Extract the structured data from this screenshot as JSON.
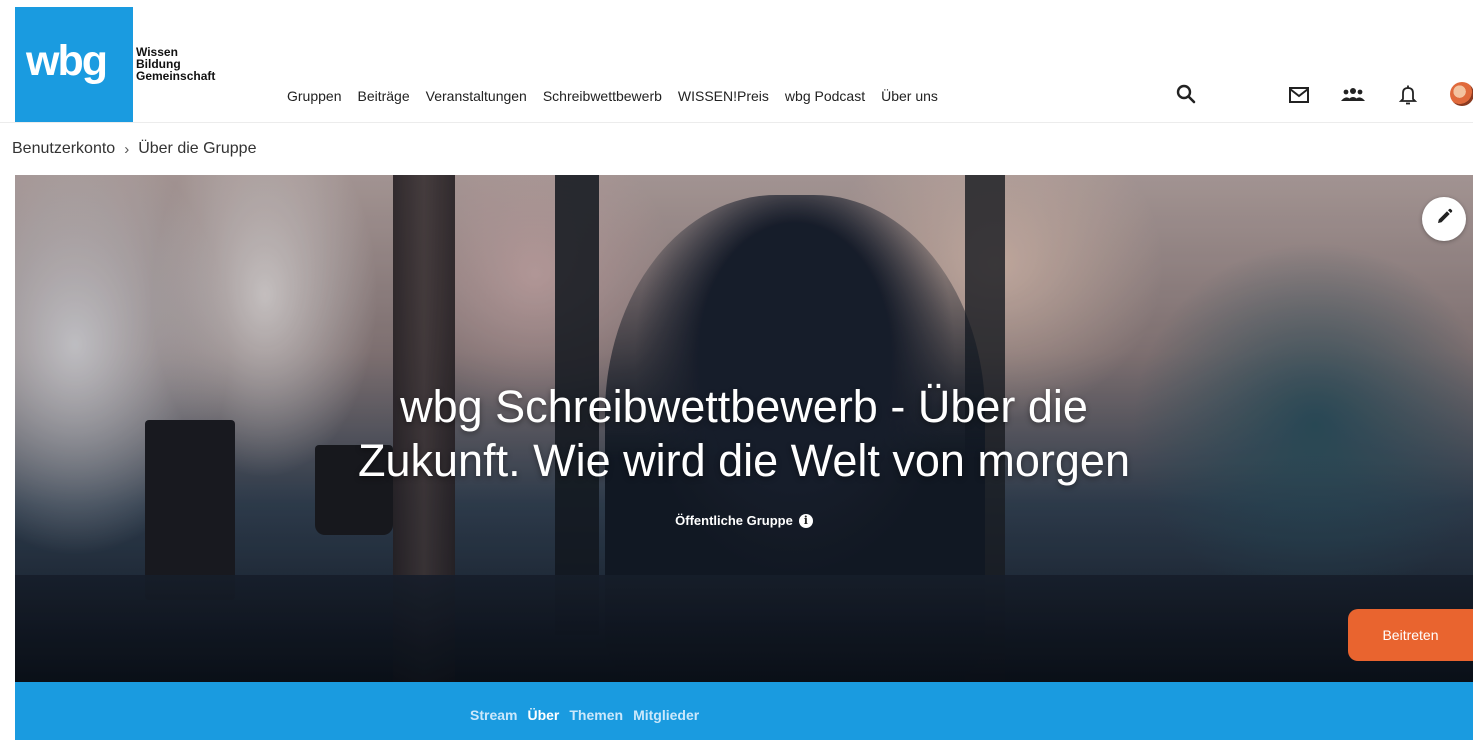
{
  "brand": {
    "logo_mark": "wbg",
    "logo_lines": [
      "Wissen",
      "Bildung",
      "Gemeinschaft"
    ],
    "primary_color": "#1a9be0",
    "accent_color": "#e9642f"
  },
  "nav": {
    "items": [
      {
        "label": "Gruppen"
      },
      {
        "label": "Beiträge"
      },
      {
        "label": "Veranstaltungen"
      },
      {
        "label": "Schreibwettbewerb"
      },
      {
        "label": "WISSEN!Preis"
      },
      {
        "label": "wbg Podcast"
      },
      {
        "label": "Über uns"
      }
    ],
    "icons": [
      "search-icon",
      "mail-icon",
      "group-icon",
      "bell-icon",
      "avatar"
    ]
  },
  "breadcrumb": {
    "items": [
      "Benutzerkonto",
      "Über die Gruppe"
    ],
    "separator": "›"
  },
  "hero": {
    "title_line1": "wbg Schreibwettbewerb - Über die",
    "title_line2": "Zukunft. Wie wird die Welt von morgen",
    "subtitle": "Öffentliche Gruppe",
    "info_glyph": "i",
    "join_label": "Beitreten",
    "edit_icon": "pencil-icon"
  },
  "tabs": {
    "items": [
      {
        "label": "Stream",
        "active": false
      },
      {
        "label": "Über",
        "active": true
      },
      {
        "label": "Themen",
        "active": false
      },
      {
        "label": "Mitglieder",
        "active": false
      }
    ]
  }
}
